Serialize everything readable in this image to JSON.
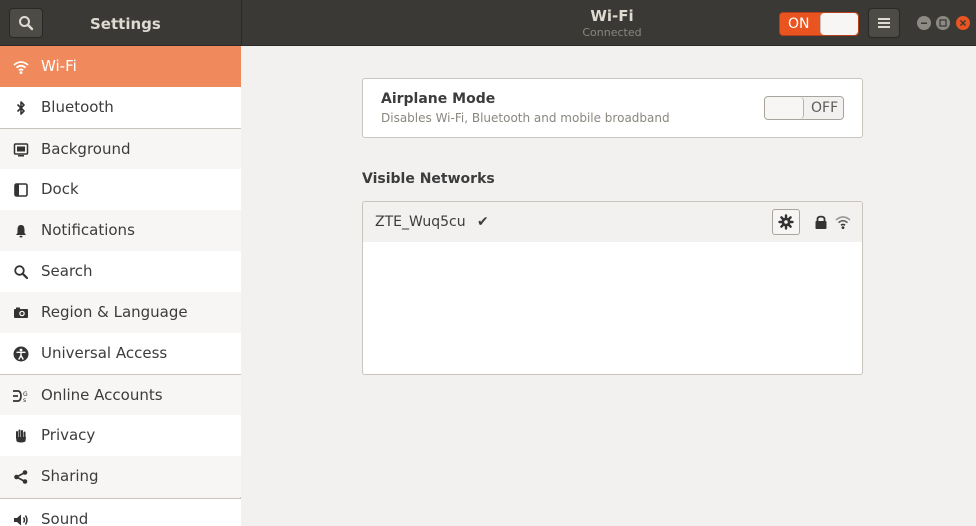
{
  "header": {
    "sidebar_title": "Settings",
    "page_title": "Wi-Fi",
    "page_subtitle": "Connected",
    "wifi_toggle_label": "ON"
  },
  "sidebar": {
    "items": [
      {
        "label": "Wi-Fi",
        "icon": "wifi-icon"
      },
      {
        "label": "Bluetooth",
        "icon": "bluetooth-icon"
      },
      {
        "label": "Background",
        "icon": "background-icon"
      },
      {
        "label": "Dock",
        "icon": "dock-icon"
      },
      {
        "label": "Notifications",
        "icon": "bell-icon"
      },
      {
        "label": "Search",
        "icon": "search-icon"
      },
      {
        "label": "Region & Language",
        "icon": "camera-icon"
      },
      {
        "label": "Universal Access",
        "icon": "accessibility-icon"
      },
      {
        "label": "Online Accounts",
        "icon": "online-accounts-icon"
      },
      {
        "label": "Privacy",
        "icon": "hand-icon"
      },
      {
        "label": "Sharing",
        "icon": "share-icon"
      },
      {
        "label": "Sound",
        "icon": "speaker-icon"
      }
    ]
  },
  "airplane": {
    "title": "Airplane Mode",
    "description": "Disables Wi-Fi, Bluetooth and mobile broadband",
    "toggle_label": "OFF"
  },
  "networks": {
    "title": "Visible Networks",
    "items": [
      {
        "name": "ZTE_Wuq5cu",
        "connected_mark": "✔"
      }
    ]
  },
  "colors": {
    "accent": "#e95420",
    "active_row": "#f08a5d",
    "header_bg": "#3a3935"
  }
}
